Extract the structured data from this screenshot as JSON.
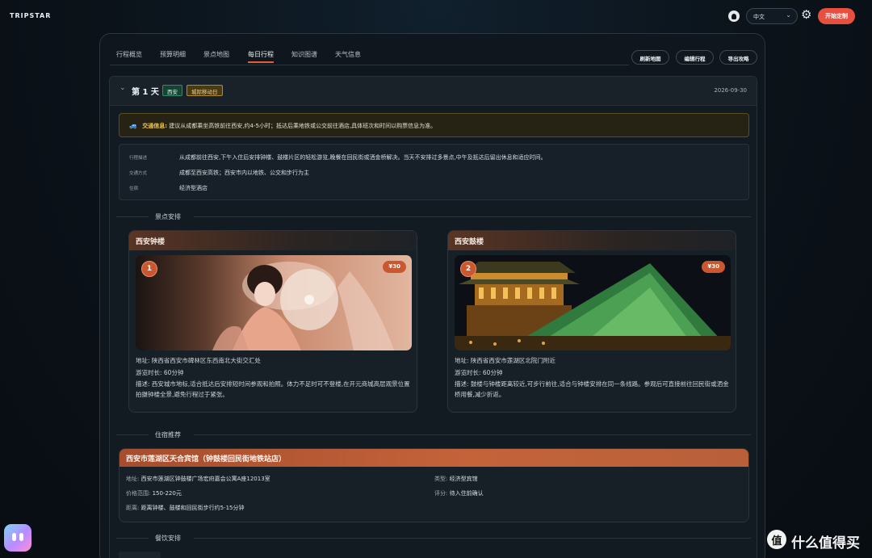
{
  "brand": "TRIPSTAR",
  "header": {
    "language": "中文",
    "start_label": "开始定制"
  },
  "tabs": [
    {
      "label": "行程概览"
    },
    {
      "label": "预算明细"
    },
    {
      "label": "景点地图"
    },
    {
      "label": "每日行程",
      "active": true
    },
    {
      "label": "知识图谱"
    },
    {
      "label": "天气信息"
    }
  ],
  "actions": {
    "refresh_map": "刷新地图",
    "edit_trip": "编辑行程",
    "export_guide": "导出攻略"
  },
  "day": {
    "title": "第 1 天",
    "city": "西安",
    "type": "城际移动日",
    "date": "2026-09-30",
    "transport": {
      "label": "交通信息:",
      "text": "建议从成都乘坐高铁前往西安,约4-5小时；抵达后乘地铁或公交前往酒店,具体班次和时间以购票信息为准。"
    },
    "details": [
      {
        "key": "行程描述",
        "value": "从成都前往西安,下午入住后安排钟楼、鼓楼片区的轻松游览,晚餐在回民街或洒金桥解决。当天不安排过多景点,中午及抵达后留出休息和适应时间。"
      },
      {
        "key": "交通方式",
        "value": "成都至西安高铁；西安市内以地铁、公交和步行为主"
      },
      {
        "key": "住宿",
        "value": "经济型酒店"
      }
    ]
  },
  "sections": {
    "spots": "景点安排",
    "hotel": "住宿推荐",
    "food": "餐饮安排"
  },
  "spots": [
    {
      "index": "1",
      "name": "西安钟楼",
      "price": "¥30",
      "address": "地址: 陕西省西安市碑林区东西南北大街交汇处",
      "duration": "游览时长: 60分钟",
      "desc": "描述: 西安城市地标,适合抵达后安排短时间参观和拍照。体力不足时可不登楼,在开元商城高层观景位置拍摄钟楼全景,避免行程过于紧张。"
    },
    {
      "index": "2",
      "name": "西安鼓楼",
      "price": "¥30",
      "address": "地址: 陕西省西安市莲湖区北院门附近",
      "duration": "游览时长: 60分钟",
      "desc": "描述: 鼓楼与钟楼距离较近,可步行前往,适合与钟楼安排在同一条线路。参观后可直接前往回民街或洒金桥用餐,减少折返。"
    }
  ],
  "hotel": {
    "name": "西安市莲湖区天合宾馆（钟鼓楼回民街地铁站店）",
    "address_key": "地址:",
    "address": "西安市莲湖区钟鼓楼广场宏府嘉会公寓A座12013室",
    "type_key": "类型:",
    "type": "经济型宾馆",
    "price_key": "价格范围:",
    "price": "150-220元",
    "rating_key": "评分:",
    "rating": "待入住前确认",
    "distance_key": "距离:",
    "distance": "距离钟楼、鼓楼和回民街步行约5-15分钟"
  },
  "watermark": {
    "logo": "值",
    "text": "什么值得买"
  },
  "icons": {
    "github": "github-icon",
    "settings": "gear-icon",
    "car": "car-icon",
    "assistant": "assistant-icon"
  }
}
